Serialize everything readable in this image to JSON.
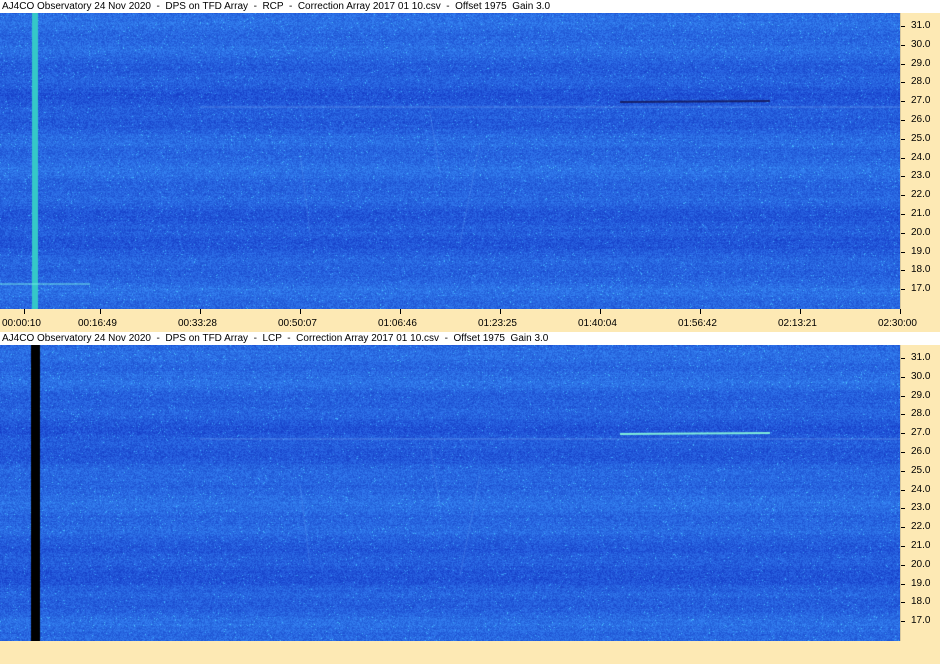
{
  "top_panel": {
    "title": "AJ4CO Observatory 24 Nov 2020  -  DPS on TFD Array  -  RCP  -  Correction Array 2017 01 10.csv  -  Offset 1975  Gain 3.0"
  },
  "bottom_panel": {
    "title": "AJ4CO Observatory 24 Nov 2020  -  DPS on TFD Array  -  LCP  -  Correction Array 2017 01 10.csv  -  Offset 1975  Gain 3.0"
  },
  "frequency_axis": {
    "labels": [
      "31.0",
      "30.0",
      "29.0",
      "28.0",
      "27.0",
      "26.0",
      "25.0",
      "24.0",
      "23.0",
      "22.0",
      "21.0",
      "20.0",
      "19.0",
      "18.0",
      "17.0"
    ]
  },
  "time_axis": {
    "labels": [
      "00:00:10",
      "00:16:49",
      "00:33:28",
      "00:50:07",
      "01:06:46",
      "01:23:25",
      "01:40:04",
      "01:56:42",
      "02:13:21",
      "02:30:00"
    ]
  },
  "colors": {
    "spectrogram_base": "#2a64e0",
    "axis_background": "#fde9b4",
    "top_stripe": "#35c8c8",
    "bottom_stripe": "#000000"
  }
}
